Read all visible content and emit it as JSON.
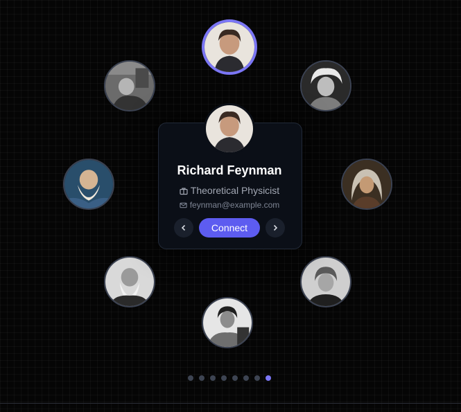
{
  "profile": {
    "name": "Richard Feynman",
    "role": "Theoretical Physicist",
    "email": "feynman@example.com",
    "connect_label": "Connect"
  },
  "icons": {
    "prev": "chevron-left-icon",
    "next": "chevron-right-icon",
    "role": "briefcase-icon",
    "email": "mail-icon"
  },
  "colors": {
    "accent": "#5d5cf0",
    "active_ring": "#7b76f5",
    "card_bg": "#0b0f17",
    "dot_inactive": "#3d4452"
  },
  "pagination": {
    "total": 8,
    "active_index": 7
  }
}
